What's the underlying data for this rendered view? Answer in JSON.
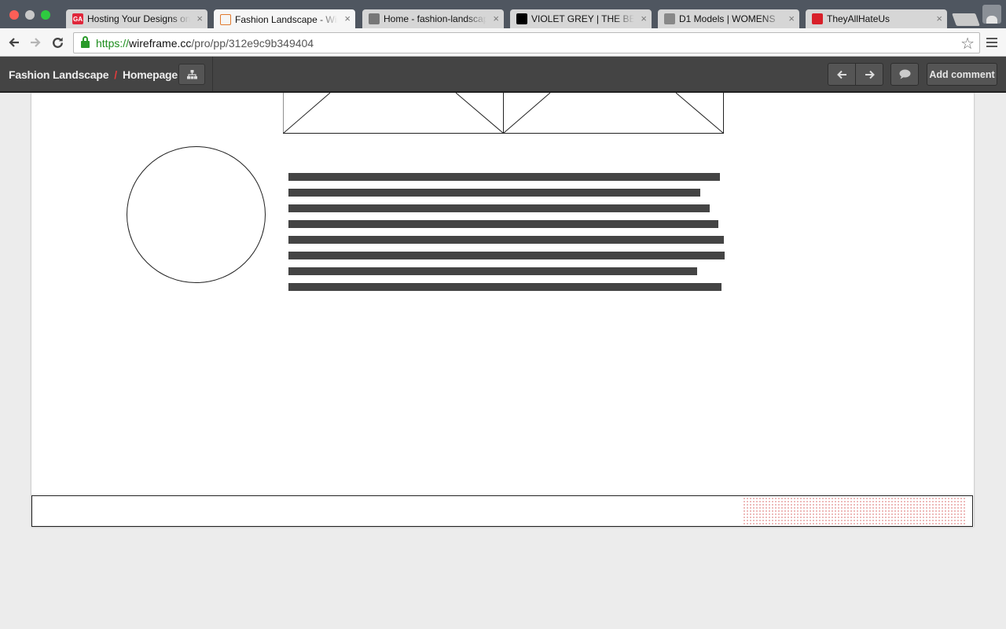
{
  "browser": {
    "tabs": [
      {
        "title": "Hosting Your Designs on",
        "favicon_text": "GA",
        "favicon_color": "#e0263a",
        "active": false
      },
      {
        "title": "Fashion Landscape - Wir",
        "favicon_text": "",
        "favicon_color": "#e07a2e",
        "active": true
      },
      {
        "title": "Home - fashion-landscap",
        "favicon_text": "",
        "favicon_color": "#777777",
        "active": false
      },
      {
        "title": "VIOLET GREY | THE BES",
        "favicon_text": "",
        "favicon_color": "#000000",
        "active": false
      },
      {
        "title": "D1 Models | WOMENS",
        "favicon_text": "",
        "favicon_color": "#888888",
        "active": false
      },
      {
        "title": "TheyAllHateUs",
        "favicon_text": "",
        "favicon_color": "#d8202a",
        "active": false
      }
    ],
    "close_glyph": "×",
    "url": {
      "scheme": "https://",
      "host": "wireframe.cc",
      "path": "/pro/pp/312e9c9b349404"
    }
  },
  "app": {
    "breadcrumb": {
      "project": "Fashion Landscape",
      "separator": "/",
      "page": "Homepage"
    },
    "buttons": {
      "sitemap_icon": "sitemap-icon",
      "prev_icon": "arrow-left-icon",
      "next_icon": "arrow-right-icon",
      "comment_icon": "speech-bubble-icon",
      "add_comment_label": "Add comment"
    },
    "colors": {
      "header_bg": "#444444",
      "separator_accent": "#e23c3c",
      "wireframe_stroke": "#222222",
      "text_placeholder": "#444444",
      "dotted_pattern": "#e9a3a3"
    }
  }
}
